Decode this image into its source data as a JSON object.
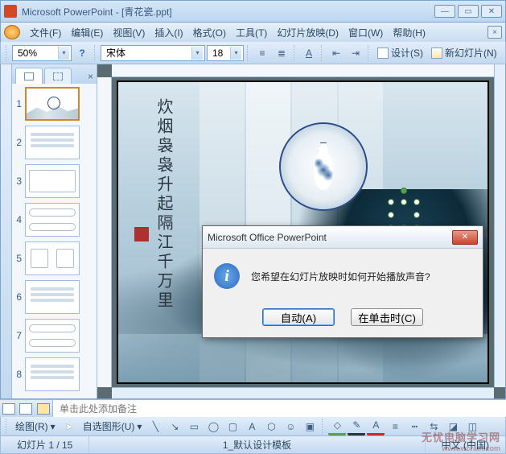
{
  "app": {
    "title": "Microsoft PowerPoint - [青花瓷.ppt]"
  },
  "menus": [
    "文件(F)",
    "编辑(E)",
    "视图(V)",
    "插入(I)",
    "格式(O)",
    "工具(T)",
    "幻灯片放映(D)",
    "窗口(W)",
    "帮助(H)"
  ],
  "toolbar": {
    "zoom": "50%",
    "font_name": "宋体",
    "font_size": "18",
    "design_label": "设计(S)",
    "newslide_label": "新幻灯片(N)"
  },
  "thumbnails": {
    "count": 8,
    "selected": 1
  },
  "slide": {
    "calligraphy_col1": "炊烟袅袅升起",
    "calligraphy_col2": "隔江千万里"
  },
  "dialog": {
    "title": "Microsoft Office PowerPoint",
    "message": "您希望在幻灯片放映时如何开始播放声音?",
    "btn_auto": "自动(A)",
    "btn_click": "在单击时(C)"
  },
  "notes": {
    "placeholder": "单击此处添加备注"
  },
  "drawbar": {
    "draw_label": "绘图(R)",
    "autoshape_label": "自选图形(U)"
  },
  "status": {
    "slide_info": "幻灯片 1 / 15",
    "template": "1_默认设计模板",
    "language": "中文 (中国)"
  },
  "watermark": {
    "main": "无忧电脑学习网",
    "sub": "www.wcrain.com"
  }
}
